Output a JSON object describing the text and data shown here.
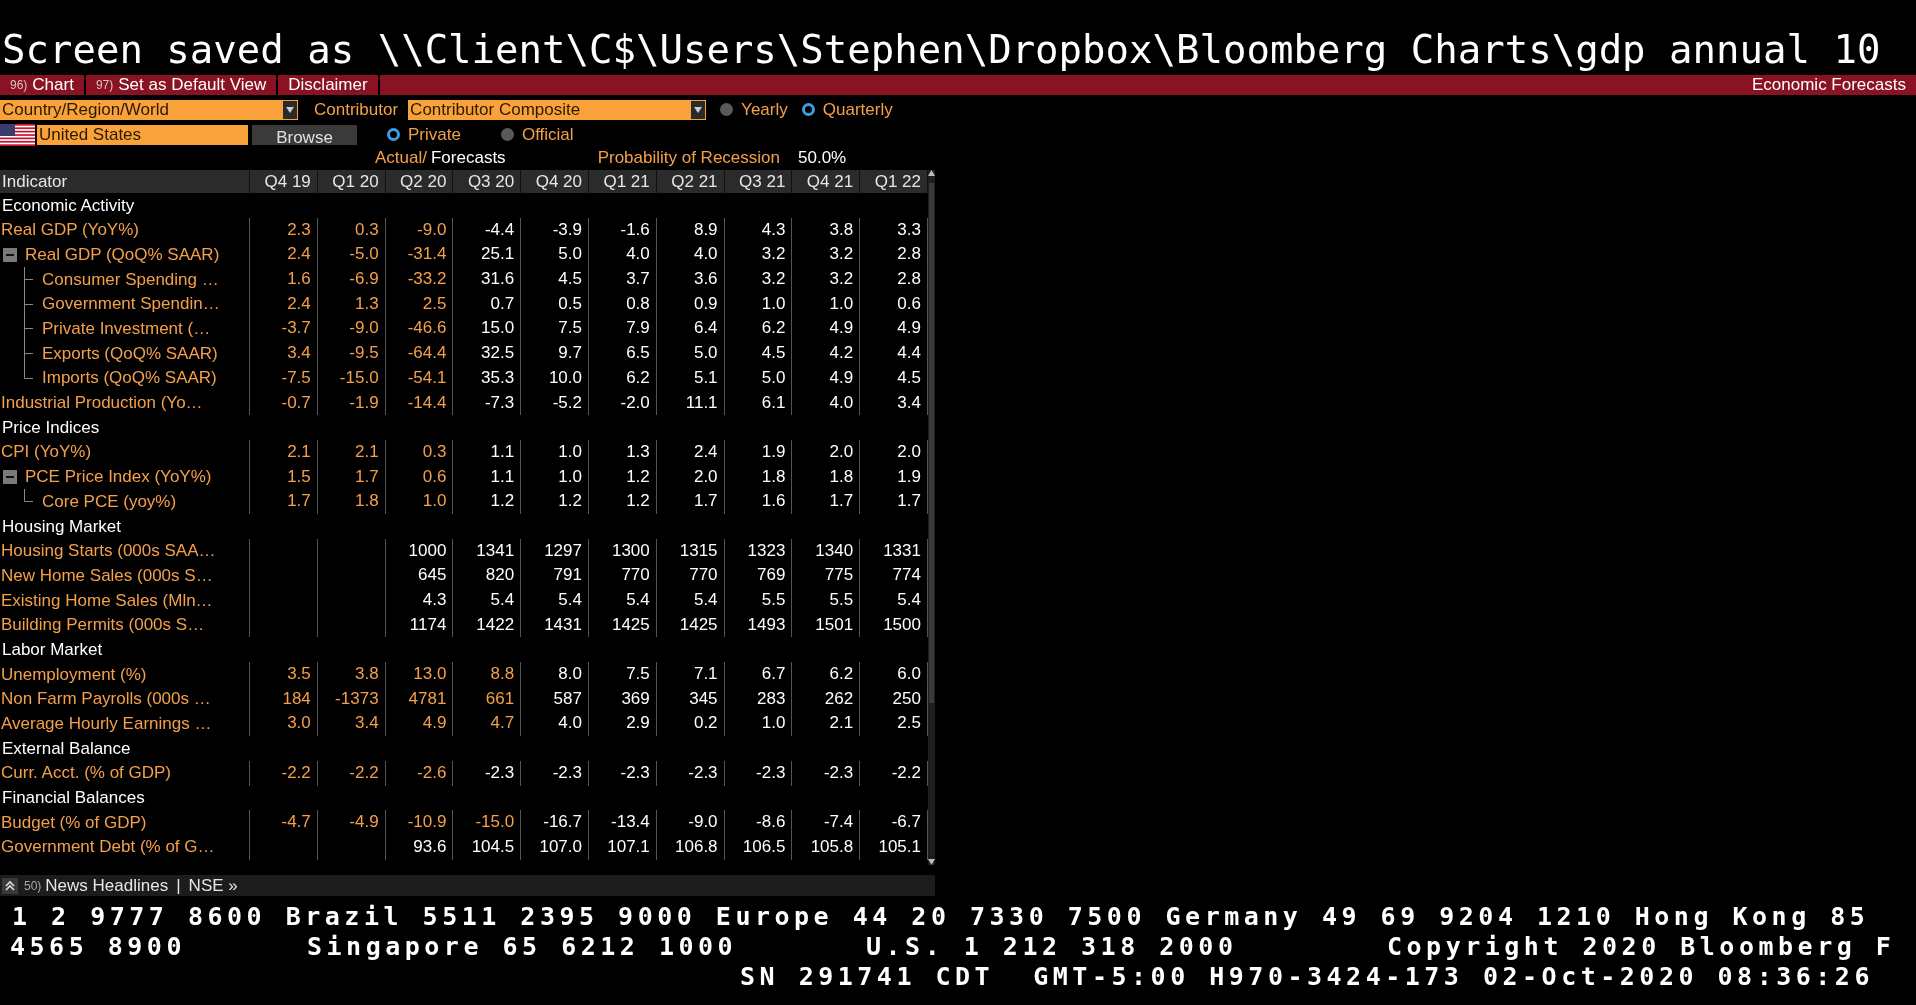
{
  "title_line": "Screen saved as \\\\Client\\C$\\Users\\Stephen\\Dropbox\\Bloomberg Charts\\gdp annual 10",
  "menu": [
    {
      "number": "96)",
      "label": "Chart"
    },
    {
      "number": "97)",
      "label": "Set as Default View"
    },
    {
      "label": "Disclaimer"
    }
  ],
  "screen_name": "Economic Forecasts",
  "country_dropdown": {
    "value": "Country/Region/World"
  },
  "contributor_label": "Contributor",
  "contributor_dropdown": {
    "value": "Contributor Composite"
  },
  "frequency": [
    {
      "label": "Yearly",
      "selected": false
    },
    {
      "label": "Quarterly",
      "selected": true
    }
  ],
  "country_field": {
    "value": "United States"
  },
  "browse_button": "Browse",
  "source": [
    {
      "label": "Private",
      "selected": true
    },
    {
      "label": "Official",
      "selected": false
    }
  ],
  "legend": {
    "actual": "Actual/",
    "forecasts": "Forecasts"
  },
  "recession": {
    "label": "Probability of Recession",
    "value": "50.0%"
  },
  "table": {
    "columns": [
      "Indicator",
      "Q4 19",
      "Q1 20",
      "Q2 20",
      "Q3 20",
      "Q4 20",
      "Q1 21",
      "Q2 21",
      "Q3 21",
      "Q4 21",
      "Q1 22"
    ],
    "sections": [
      {
        "title": "Economic Activity",
        "rows": [
          {
            "label": "Real GDP (YoY%)",
            "cells": [
              {
                "value": "2.3",
                "actual": true
              },
              {
                "value": "0.3",
                "actual": true
              },
              {
                "value": "-9.0",
                "actual": true
              },
              {
                "value": "-4.4",
                "actual": false
              },
              {
                "value": "-3.9",
                "actual": false
              },
              {
                "value": "-1.6",
                "actual": false
              },
              {
                "value": "8.9",
                "actual": false
              },
              {
                "value": "4.3",
                "actual": false
              },
              {
                "value": "3.8",
                "actual": false
              },
              {
                "value": "3.3",
                "actual": false
              }
            ]
          },
          {
            "label": "Real GDP (QoQ% SAAR)",
            "expanded": true,
            "cells": [
              {
                "value": "2.4",
                "actual": true
              },
              {
                "value": "-5.0",
                "actual": true
              },
              {
                "value": "-31.4",
                "actual": true
              },
              {
                "value": "25.1",
                "actual": false
              },
              {
                "value": "5.0",
                "actual": false
              },
              {
                "value": "4.0",
                "actual": false
              },
              {
                "value": "4.0",
                "actual": false
              },
              {
                "value": "3.2",
                "actual": false
              },
              {
                "value": "3.2",
                "actual": false
              },
              {
                "value": "2.8",
                "actual": false
              }
            ],
            "children": [
              {
                "label": "Consumer Spending …",
                "cells": [
                  {
                    "value": "1.6",
                    "actual": true
                  },
                  {
                    "value": "-6.9",
                    "actual": true
                  },
                  {
                    "value": "-33.2",
                    "actual": true
                  },
                  {
                    "value": "31.6",
                    "actual": false
                  },
                  {
                    "value": "4.5",
                    "actual": false
                  },
                  {
                    "value": "3.7",
                    "actual": false
                  },
                  {
                    "value": "3.6",
                    "actual": false
                  },
                  {
                    "value": "3.2",
                    "actual": false
                  },
                  {
                    "value": "3.2",
                    "actual": false
                  },
                  {
                    "value": "2.8",
                    "actual": false
                  }
                ]
              },
              {
                "label": "Government Spendin…",
                "cells": [
                  {
                    "value": "2.4",
                    "actual": true
                  },
                  {
                    "value": "1.3",
                    "actual": true
                  },
                  {
                    "value": "2.5",
                    "actual": true
                  },
                  {
                    "value": "0.7",
                    "actual": false
                  },
                  {
                    "value": "0.5",
                    "actual": false
                  },
                  {
                    "value": "0.8",
                    "actual": false
                  },
                  {
                    "value": "0.9",
                    "actual": false
                  },
                  {
                    "value": "1.0",
                    "actual": false
                  },
                  {
                    "value": "1.0",
                    "actual": false
                  },
                  {
                    "value": "0.6",
                    "actual": false
                  }
                ]
              },
              {
                "label": "Private Investment (…",
                "cells": [
                  {
                    "value": "-3.7",
                    "actual": true
                  },
                  {
                    "value": "-9.0",
                    "actual": true
                  },
                  {
                    "value": "-46.6",
                    "actual": true
                  },
                  {
                    "value": "15.0",
                    "actual": false
                  },
                  {
                    "value": "7.5",
                    "actual": false
                  },
                  {
                    "value": "7.9",
                    "actual": false
                  },
                  {
                    "value": "6.4",
                    "actual": false
                  },
                  {
                    "value": "6.2",
                    "actual": false
                  },
                  {
                    "value": "4.9",
                    "actual": false
                  },
                  {
                    "value": "4.9",
                    "actual": false
                  }
                ]
              },
              {
                "label": "Exports (QoQ% SAAR)",
                "cells": [
                  {
                    "value": "3.4",
                    "actual": true
                  },
                  {
                    "value": "-9.5",
                    "actual": true
                  },
                  {
                    "value": "-64.4",
                    "actual": true
                  },
                  {
                    "value": "32.5",
                    "actual": false
                  },
                  {
                    "value": "9.7",
                    "actual": false
                  },
                  {
                    "value": "6.5",
                    "actual": false
                  },
                  {
                    "value": "5.0",
                    "actual": false
                  },
                  {
                    "value": "4.5",
                    "actual": false
                  },
                  {
                    "value": "4.2",
                    "actual": false
                  },
                  {
                    "value": "4.4",
                    "actual": false
                  }
                ]
              },
              {
                "label": "Imports (QoQ% SAAR)",
                "cells": [
                  {
                    "value": "-7.5",
                    "actual": true
                  },
                  {
                    "value": "-15.0",
                    "actual": true
                  },
                  {
                    "value": "-54.1",
                    "actual": true
                  },
                  {
                    "value": "35.3",
                    "actual": false
                  },
                  {
                    "value": "10.0",
                    "actual": false
                  },
                  {
                    "value": "6.2",
                    "actual": false
                  },
                  {
                    "value": "5.1",
                    "actual": false
                  },
                  {
                    "value": "5.0",
                    "actual": false
                  },
                  {
                    "value": "4.9",
                    "actual": false
                  },
                  {
                    "value": "4.5",
                    "actual": false
                  }
                ]
              }
            ]
          },
          {
            "label": "Industrial Production (Yo…",
            "cells": [
              {
                "value": "-0.7",
                "actual": true
              },
              {
                "value": "-1.9",
                "actual": true
              },
              {
                "value": "-14.4",
                "actual": true
              },
              {
                "value": "-7.3",
                "actual": false
              },
              {
                "value": "-5.2",
                "actual": false
              },
              {
                "value": "-2.0",
                "actual": false
              },
              {
                "value": "11.1",
                "actual": false
              },
              {
                "value": "6.1",
                "actual": false
              },
              {
                "value": "4.0",
                "actual": false
              },
              {
                "value": "3.4",
                "actual": false
              }
            ]
          }
        ]
      },
      {
        "title": "Price Indices",
        "rows": [
          {
            "label": "CPI (YoY%)",
            "cells": [
              {
                "value": "2.1",
                "actual": true
              },
              {
                "value": "2.1",
                "actual": true
              },
              {
                "value": "0.3",
                "actual": true
              },
              {
                "value": "1.1",
                "actual": false
              },
              {
                "value": "1.0",
                "actual": false
              },
              {
                "value": "1.3",
                "actual": false
              },
              {
                "value": "2.4",
                "actual": false
              },
              {
                "value": "1.9",
                "actual": false
              },
              {
                "value": "2.0",
                "actual": false
              },
              {
                "value": "2.0",
                "actual": false
              }
            ]
          },
          {
            "label": "PCE Price Index (YoY%)",
            "expanded": true,
            "cells": [
              {
                "value": "1.5",
                "actual": true
              },
              {
                "value": "1.7",
                "actual": true
              },
              {
                "value": "0.6",
                "actual": true
              },
              {
                "value": "1.1",
                "actual": false
              },
              {
                "value": "1.0",
                "actual": false
              },
              {
                "value": "1.2",
                "actual": false
              },
              {
                "value": "2.0",
                "actual": false
              },
              {
                "value": "1.8",
                "actual": false
              },
              {
                "value": "1.8",
                "actual": false
              },
              {
                "value": "1.9",
                "actual": false
              }
            ],
            "children": [
              {
                "label": "Core PCE (yoy%)",
                "cells": [
                  {
                    "value": "1.7",
                    "actual": true
                  },
                  {
                    "value": "1.8",
                    "actual": true
                  },
                  {
                    "value": "1.0",
                    "actual": true
                  },
                  {
                    "value": "1.2",
                    "actual": false
                  },
                  {
                    "value": "1.2",
                    "actual": false
                  },
                  {
                    "value": "1.2",
                    "actual": false
                  },
                  {
                    "value": "1.7",
                    "actual": false
                  },
                  {
                    "value": "1.6",
                    "actual": false
                  },
                  {
                    "value": "1.7",
                    "actual": false
                  },
                  {
                    "value": "1.7",
                    "actual": false
                  }
                ]
              }
            ]
          }
        ]
      },
      {
        "title": "Housing Market",
        "rows": [
          {
            "label": "Housing Starts (000s SAA…",
            "cells": [
              {},
              {},
              {
                "value": "1000",
                "actual": false
              },
              {
                "value": "1341",
                "actual": false
              },
              {
                "value": "1297",
                "actual": false
              },
              {
                "value": "1300",
                "actual": false
              },
              {
                "value": "1315",
                "actual": false
              },
              {
                "value": "1323",
                "actual": false
              },
              {
                "value": "1340",
                "actual": false
              },
              {
                "value": "1331",
                "actual": false
              }
            ]
          },
          {
            "label": "New Home Sales (000s S…",
            "cells": [
              {},
              {},
              {
                "value": "645",
                "actual": false
              },
              {
                "value": "820",
                "actual": false
              },
              {
                "value": "791",
                "actual": false
              },
              {
                "value": "770",
                "actual": false
              },
              {
                "value": "770",
                "actual": false
              },
              {
                "value": "769",
                "actual": false
              },
              {
                "value": "775",
                "actual": false
              },
              {
                "value": "774",
                "actual": false
              }
            ]
          },
          {
            "label": "Existing Home Sales (Mln…",
            "cells": [
              {},
              {},
              {
                "value": "4.3",
                "actual": false
              },
              {
                "value": "5.4",
                "actual": false
              },
              {
                "value": "5.4",
                "actual": false
              },
              {
                "value": "5.4",
                "actual": false
              },
              {
                "value": "5.4",
                "actual": false
              },
              {
                "value": "5.5",
                "actual": false
              },
              {
                "value": "5.5",
                "actual": false
              },
              {
                "value": "5.4",
                "actual": false
              }
            ]
          },
          {
            "label": "Building Permits (000s S…",
            "cells": [
              {},
              {},
              {
                "value": "1174",
                "actual": false
              },
              {
                "value": "1422",
                "actual": false
              },
              {
                "value": "1431",
                "actual": false
              },
              {
                "value": "1425",
                "actual": false
              },
              {
                "value": "1425",
                "actual": false
              },
              {
                "value": "1493",
                "actual": false
              },
              {
                "value": "1501",
                "actual": false
              },
              {
                "value": "1500",
                "actual": false
              }
            ]
          }
        ]
      },
      {
        "title": "Labor Market",
        "rows": [
          {
            "label": "Unemployment (%)",
            "cells": [
              {
                "value": "3.5",
                "actual": true
              },
              {
                "value": "3.8",
                "actual": true
              },
              {
                "value": "13.0",
                "actual": true
              },
              {
                "value": "8.8",
                "actual": true
              },
              {
                "value": "8.0",
                "actual": false
              },
              {
                "value": "7.5",
                "actual": false
              },
              {
                "value": "7.1",
                "actual": false
              },
              {
                "value": "6.7",
                "actual": false
              },
              {
                "value": "6.2",
                "actual": false
              },
              {
                "value": "6.0",
                "actual": false
              }
            ]
          },
          {
            "label": "Non Farm Payrolls (000s …",
            "cells": [
              {
                "value": "184",
                "actual": true
              },
              {
                "value": "-1373",
                "actual": true
              },
              {
                "value": "4781",
                "actual": true
              },
              {
                "value": "661",
                "actual": true
              },
              {
                "value": "587",
                "actual": false
              },
              {
                "value": "369",
                "actual": false
              },
              {
                "value": "345",
                "actual": false
              },
              {
                "value": "283",
                "actual": false
              },
              {
                "value": "262",
                "actual": false
              },
              {
                "value": "250",
                "actual": false
              }
            ]
          },
          {
            "label": "Average Hourly Earnings …",
            "cells": [
              {
                "value": "3.0",
                "actual": true
              },
              {
                "value": "3.4",
                "actual": true
              },
              {
                "value": "4.9",
                "actual": true
              },
              {
                "value": "4.7",
                "actual": true
              },
              {
                "value": "4.0",
                "actual": false
              },
              {
                "value": "2.9",
                "actual": false
              },
              {
                "value": "0.2",
                "actual": false
              },
              {
                "value": "1.0",
                "actual": false
              },
              {
                "value": "2.1",
                "actual": false
              },
              {
                "value": "2.5",
                "actual": false
              }
            ]
          }
        ]
      },
      {
        "title": "External Balance",
        "rows": [
          {
            "label": "Curr. Acct. (% of GDP)",
            "cells": [
              {
                "value": "-2.2",
                "actual": true
              },
              {
                "value": "-2.2",
                "actual": true
              },
              {
                "value": "-2.6",
                "actual": true
              },
              {
                "value": "-2.3",
                "actual": false
              },
              {
                "value": "-2.3",
                "actual": false
              },
              {
                "value": "-2.3",
                "actual": false
              },
              {
                "value": "-2.3",
                "actual": false
              },
              {
                "value": "-2.3",
                "actual": false
              },
              {
                "value": "-2.3",
                "actual": false
              },
              {
                "value": "-2.2",
                "actual": false
              }
            ]
          }
        ]
      },
      {
        "title": "Financial Balances",
        "rows": [
          {
            "label": "Budget (% of GDP)",
            "cells": [
              {
                "value": "-4.7",
                "actual": true
              },
              {
                "value": "-4.9",
                "actual": true
              },
              {
                "value": "-10.9",
                "actual": true
              },
              {
                "value": "-15.0",
                "actual": true
              },
              {
                "value": "-16.7",
                "actual": false
              },
              {
                "value": "-13.4",
                "actual": false
              },
              {
                "value": "-9.0",
                "actual": false
              },
              {
                "value": "-8.6",
                "actual": false
              },
              {
                "value": "-7.4",
                "actual": false
              },
              {
                "value": "-6.7",
                "actual": false
              }
            ]
          },
          {
            "label": "Government Debt (% of G…",
            "cells": [
              {},
              {},
              {
                "value": "93.6",
                "actual": false
              },
              {
                "value": "104.5",
                "actual": false
              },
              {
                "value": "107.0",
                "actual": false
              },
              {
                "value": "107.1",
                "actual": false
              },
              {
                "value": "106.8",
                "actual": false
              },
              {
                "value": "106.5",
                "actual": false
              },
              {
                "value": "105.8",
                "actual": false
              },
              {
                "value": "105.1",
                "actual": false
              }
            ]
          }
        ]
      }
    ]
  },
  "news_bar": {
    "number": "50)",
    "label": "News Headlines",
    "separator": "|",
    "link": "NSE »"
  },
  "ticker": {
    "line_1": [
      "1 2 9777 8600 Brazil 5511 2395 9000 Europe 44 20 7330 7500 Germany 49 69 9204 1210 Hong Kong 85"
    ],
    "line_2": [
      "4565 8900",
      "Singapore 65 6212 1000",
      "U.S. 1 212 318 2000",
      "Copyright 2020 Bloomberg F"
    ],
    "line_3": [
      "SN 291741 CDT  GMT-5:00 H970-3424-173 02-Oct-2020 08:36:26"
    ]
  }
}
